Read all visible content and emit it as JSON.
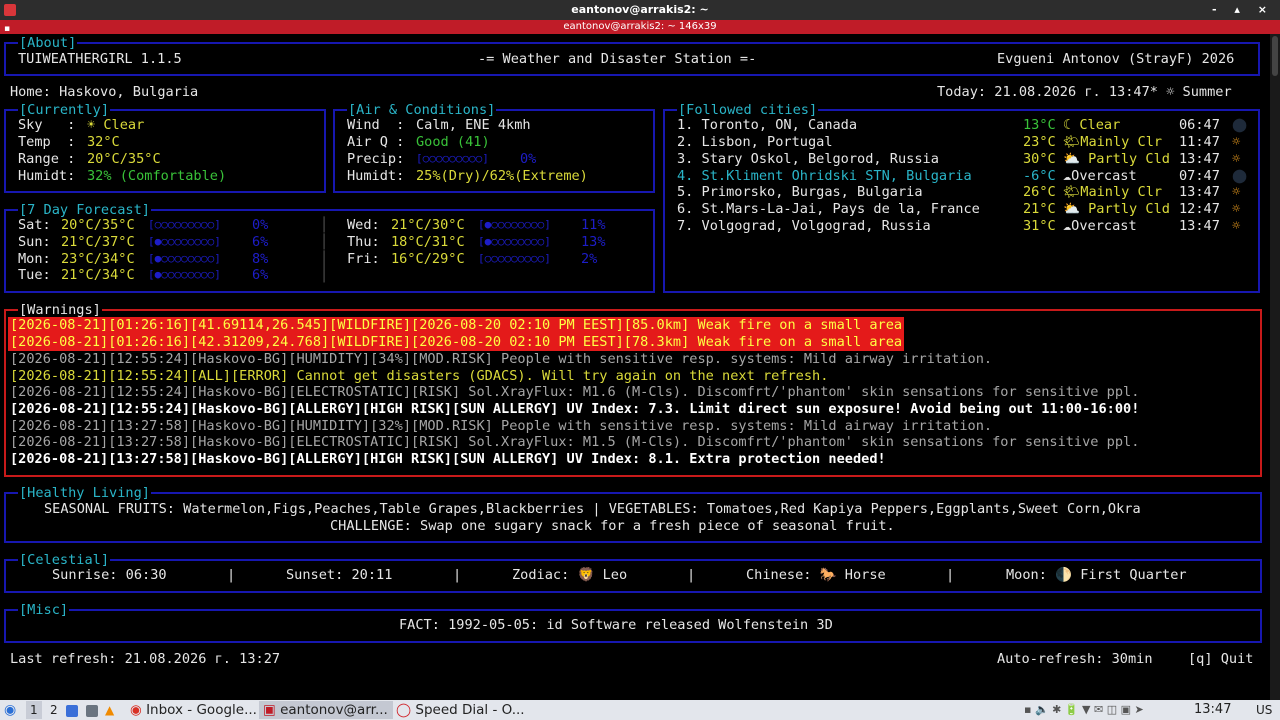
{
  "window": {
    "title": "eantonov@arrakis2: ~",
    "tab_title": "eantonov@arrakis2: ~ 146x39",
    "controls": "- ▴ ×"
  },
  "about": {
    "label": "[About]",
    "app_name": "TUIWEATHERGIRL 1.1.5",
    "subtitle": "-= Weather and Disaster Station =-",
    "author": "Evgueni Antonov (StrayF) 2026"
  },
  "status_line": {
    "home": "Home: Haskovo, Bulgaria",
    "today": "Today: 21.08.2026 г. 13:47* ☼ Summer"
  },
  "currently": {
    "label": "[Currently]",
    "sky_label": "Sky   :",
    "sky_value": "☀ Clear",
    "temp_label": "Temp  :",
    "temp_value": "32°C",
    "range_label": "Range :",
    "range_value": "20°C/35°C",
    "humid_label": "Humidt:",
    "humid_value": "32% (Comfortable)"
  },
  "air": {
    "label": "[Air & Conditions]",
    "wind_label": "Wind  :",
    "wind_value": "Calm, ENE 4kmh",
    "airq_label": "Air Q :",
    "airq_value": "Good (41)",
    "precip_label": "Precip:",
    "precip_bar": "[○○○○○○○○○]",
    "precip_pct": "0%",
    "humid_label": "Humidt:",
    "humid_value": "25%(Dry)/62%(Extreme)"
  },
  "followed": {
    "label": "[Followed cities]",
    "cities": [
      {
        "name": "1. Toronto, ON, Canada",
        "temp": "13°C",
        "cond": "☾ Clear",
        "time": "06:47",
        "icon": "⬤"
      },
      {
        "name": "2. Lisbon, Portugal",
        "temp": "23°C",
        "cond": "🌤Mainly Clr",
        "time": "11:47",
        "icon": "☼"
      },
      {
        "name": "3. Stary Oskol, Belgorod, Russia",
        "temp": "30°C",
        "cond": "⛅ Partly Cld",
        "time": "13:47",
        "icon": "☼"
      },
      {
        "name": "4. St.Kliment Ohridski STN, Bulgaria",
        "temp": "-6°C",
        "cond": "☁Overcast",
        "time": "07:47",
        "icon": "⬤"
      },
      {
        "name": "5. Primorsko, Burgas, Bulgaria",
        "temp": "26°C",
        "cond": "🌤Mainly Clr",
        "time": "13:47",
        "icon": "☼"
      },
      {
        "name": "6. St.Mars-La-Jai, Pays de la, France",
        "temp": "21°C",
        "cond": "⛅ Partly Cld",
        "time": "12:47",
        "icon": "☼"
      },
      {
        "name": "7. Volgograd, Volgograd, Russia",
        "temp": "31°C",
        "cond": "☁Overcast",
        "time": "13:47",
        "icon": "☼"
      }
    ]
  },
  "forecast": {
    "label": "[7 Day Forecast]",
    "left": [
      {
        "day": "Sat:",
        "range": "20°C/35°C",
        "bar": "[○○○○○○○○○]",
        "pct": "0%"
      },
      {
        "day": "Sun:",
        "range": "21°C/37°C",
        "bar": "[●○○○○○○○○]",
        "pct": "6%"
      },
      {
        "day": "Mon:",
        "range": "23°C/34°C",
        "bar": "[●○○○○○○○○]",
        "pct": "8%"
      },
      {
        "day": "Tue:",
        "range": "21°C/34°C",
        "bar": "[●○○○○○○○○]",
        "pct": "6%"
      }
    ],
    "right": [
      {
        "day": "Wed:",
        "range": "21°C/30°C",
        "bar": "[●○○○○○○○○]",
        "pct": "11%"
      },
      {
        "day": "Thu:",
        "range": "18°C/31°C",
        "bar": "[●○○○○○○○○]",
        "pct": "13%"
      },
      {
        "day": "Fri:",
        "range": "16°C/29°C",
        "bar": "[○○○○○○○○○]",
        "pct": "2%"
      }
    ],
    "divider": "│"
  },
  "warnings": {
    "label": "[Warnings]",
    "lines": [
      "[2026-08-21][01:26:16][41.69114,26.545][WILDFIRE][2026-08-20 02:10 PM EEST][85.0km] Weak fire on a small area",
      "[2026-08-21][01:26:16][42.31209,24.768][WILDFIRE][2026-08-20 02:10 PM EEST][78.3km] Weak fire on a small area",
      "[2026-08-21][12:55:24][Haskovo-BG][HUMIDITY][34%][MOD.RISK] People with sensitive resp. systems: Mild airway irritation.",
      "[2026-08-21][12:55:24][ALL][ERROR] Cannot get disasters (GDACS). Will try again on the next refresh.",
      "[2026-08-21][12:55:24][Haskovo-BG][ELECTROSTATIC][RISK] Sol.XrayFlux: M1.6 (M-Cls). Discomfrt/'phantom' skin sensations for sensitive ppl.",
      "[2026-08-21][12:55:24][Haskovo-BG][ALLERGY][HIGH RISK][SUN ALLERGY] UV Index: 7.3. Limit direct sun exposure! Avoid being out 11:00-16:00!",
      "[2026-08-21][13:27:58][Haskovo-BG][HUMIDITY][32%][MOD.RISK] People with sensitive resp. systems: Mild airway irritation.",
      "[2026-08-21][13:27:58][Haskovo-BG][ELECTROSTATIC][RISK] Sol.XrayFlux: M1.5 (M-Cls). Discomfrt/'phantom' skin sensations for sensitive ppl.",
      "[2026-08-21][13:27:58][Haskovo-BG][ALLERGY][HIGH RISK][SUN ALLERGY] UV Index: 8.1. Extra protection needed!"
    ]
  },
  "healthy": {
    "label": "[Healthy Living]",
    "line1": "SEASONAL FRUITS: Watermelon,Figs,Peaches,Table Grapes,Blackberries | VEGETABLES: Tomatoes,Red Kapiya Peppers,Eggplants,Sweet Corn,Okra",
    "line2": "CHALLENGE: Swap one sugary snack for a fresh piece of seasonal fruit."
  },
  "celestial": {
    "label": "[Celestial]",
    "sunrise": "Sunrise: 06:30",
    "sunset": "Sunset: 20:11",
    "zodiac": "Zodiac: 🦁 Leo",
    "chinese": "Chinese: 🐎 Horse",
    "moon": "Moon: 🌓 First Quarter",
    "sep": "|"
  },
  "misc": {
    "label": "[Misc]",
    "fact": "FACT: 1992-05-05: id Software released Wolfenstein 3D"
  },
  "footer": {
    "last_refresh": "Last refresh: 21.08.2026 г. 13:27",
    "auto_refresh": "Auto-refresh: 30min",
    "quit": "[q] Quit"
  },
  "taskbar": {
    "ws1": "1",
    "ws2": "2",
    "tasks": [
      "Inbox - Google...",
      "eantonov@arr...",
      "Speed Dial - O..."
    ],
    "tray_icons": "▪ 🔈 ✱ 🔋 ▼ ✉ ◫ ▣ ➤",
    "clock": "13:47",
    "layout": "US"
  },
  "colors": {
    "border": "#1717b0",
    "warn_border": "#c81a1a",
    "highlight": "#e41a1a",
    "title_bar": "#c01c28"
  }
}
